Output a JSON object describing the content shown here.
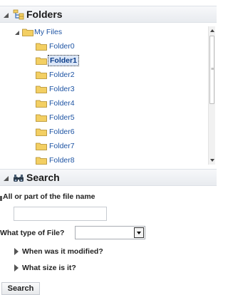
{
  "folders_panel": {
    "title": "Folders",
    "icon": "folders-icon",
    "tree": {
      "root": {
        "label": "My Files",
        "icon": "folder-icon"
      },
      "children": [
        {
          "label": "Folder0",
          "icon": "folder-icon",
          "selected": false
        },
        {
          "label": "Folder1",
          "icon": "folder-icon",
          "selected": true
        },
        {
          "label": "Folder2",
          "icon": "folder-icon",
          "selected": false
        },
        {
          "label": "Folder3",
          "icon": "folder-icon",
          "selected": false
        },
        {
          "label": "Folder4",
          "icon": "folder-icon",
          "selected": false
        },
        {
          "label": "Folder5",
          "icon": "folder-icon",
          "selected": false
        },
        {
          "label": "Folder6",
          "icon": "folder-icon",
          "selected": false
        },
        {
          "label": "Folder7",
          "icon": "folder-icon",
          "selected": false
        },
        {
          "label": "Folder8",
          "icon": "folder-icon",
          "selected": false
        }
      ]
    }
  },
  "search_panel": {
    "title": "Search",
    "icon": "binoculars-icon",
    "file_name_label": "All or part of the file name",
    "file_name_value": "",
    "file_type_label": "What type of File?",
    "file_type_selected": "",
    "modified_label": "When was it modified?",
    "size_label": "What size is it?",
    "search_button": "Search"
  },
  "colors": {
    "link_blue": "#1f55a4",
    "folder_yellow": "#f3cf63",
    "header_bg": "#e8ebef"
  }
}
